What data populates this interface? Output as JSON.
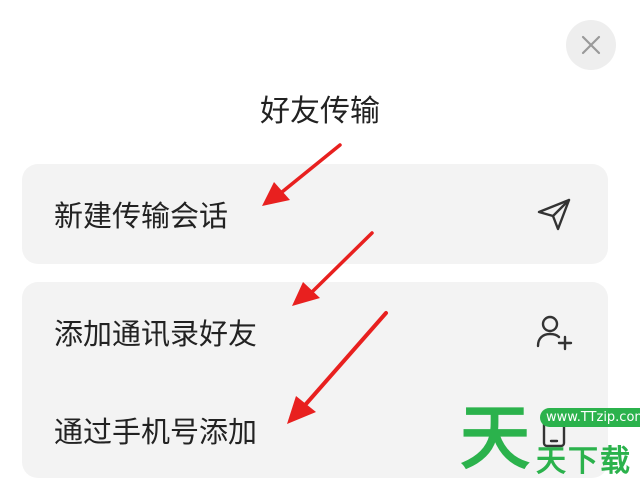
{
  "dialog": {
    "title": "好友传输",
    "close_icon": "close-icon"
  },
  "items": [
    {
      "label": "新建传输会话",
      "icon": "send-icon"
    },
    {
      "label": "添加通讯录好友",
      "icon": "add-contact-icon"
    },
    {
      "label": "通过手机号添加",
      "icon": "phone-icon"
    }
  ],
  "watermark": {
    "url": "www.TTzip.com",
    "big_char": "天",
    "text": "天下载"
  },
  "colors": {
    "card_bg": "#f3f3f3",
    "arrow": "#e8201f",
    "watermark": "#2bb24c"
  }
}
